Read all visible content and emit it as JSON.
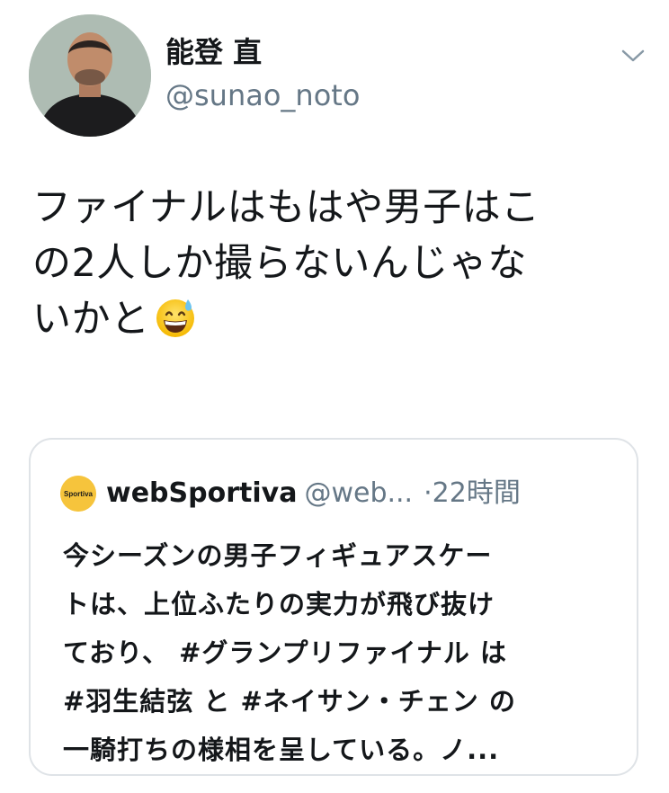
{
  "author": {
    "display_name": "能登 直",
    "handle": "@sunao_noto",
    "avatar_icon": "profile-photo",
    "menu_icon": "chevron-down-icon"
  },
  "tweet": {
    "lines": [
      "ファイナルはもはや男子はこ",
      "の2人しか撮らないんじゃな",
      "いかと"
    ],
    "emoji": "grinning-face-with-sweat-emoji"
  },
  "quote": {
    "logo": "Sportiva",
    "name": "webSportiva",
    "handle": "@web...",
    "time": "·22時間",
    "lines": [
      "今シーズンの男子フィギュアスケー",
      "トは、上位ふたりの実力が飛び抜け",
      "ており、 #グランプリファイナル は",
      "#羽生結弦 と #ネイサン・チェン の",
      "一騎打ちの様相を呈している。ノ..."
    ]
  },
  "colors": {
    "text_primary": "#14171a",
    "text_secondary": "#657786",
    "border": "#dfe3e7",
    "logo_yellow": "#f6c43c"
  }
}
